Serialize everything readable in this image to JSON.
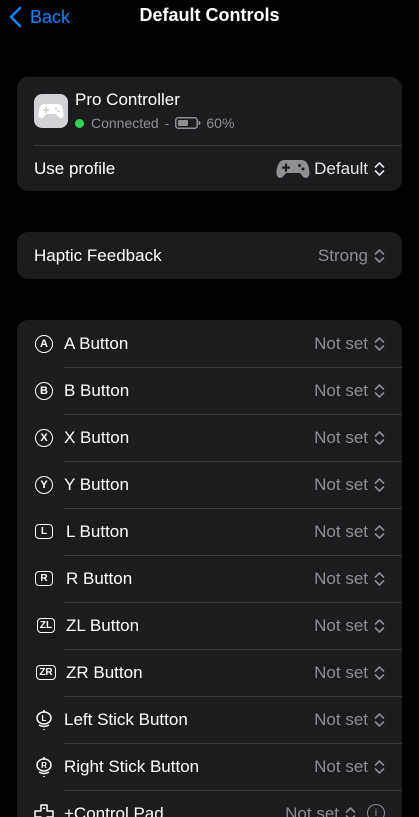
{
  "nav": {
    "back_label": "Back",
    "title": "Default Controls"
  },
  "device": {
    "name": "Pro Controller",
    "status": "Connected",
    "battery": "60%",
    "profile_label": "Use profile",
    "profile_value": "Default"
  },
  "haptics": {
    "label": "Haptic Feedback",
    "value": "Strong"
  },
  "buttons": [
    {
      "glyph": "A",
      "label": "A Button",
      "value": "Not set"
    },
    {
      "glyph": "B",
      "label": "B Button",
      "value": "Not set"
    },
    {
      "glyph": "X",
      "label": "X Button",
      "value": "Not set"
    },
    {
      "glyph": "Y",
      "label": "Y Button",
      "value": "Not set"
    },
    {
      "glyph": "L",
      "label": "L Button",
      "value": "Not set"
    },
    {
      "glyph": "R",
      "label": "R Button",
      "value": "Not set"
    },
    {
      "glyph": "ZL",
      "label": "ZL Button",
      "value": "Not set"
    },
    {
      "glyph": "ZR",
      "label": "ZR Button",
      "value": "Not set"
    },
    {
      "glyph": "L",
      "label": "Left Stick Button",
      "value": "Not set"
    },
    {
      "glyph": "R",
      "label": "Right Stick Button",
      "value": "Not set"
    },
    {
      "glyph": "",
      "label": "+Control Pad",
      "value": "Not set"
    }
  ],
  "colors": {
    "accent": "#0a84ff",
    "connected": "#30d158",
    "card": "#1c1c1e",
    "secondary": "#8e8e93"
  },
  "icons": [
    "chevron-left-icon",
    "gamepad-icon",
    "battery-icon",
    "up-down-chevron-icon",
    "info-icon",
    "dpad-icon",
    "stick-icon"
  ]
}
